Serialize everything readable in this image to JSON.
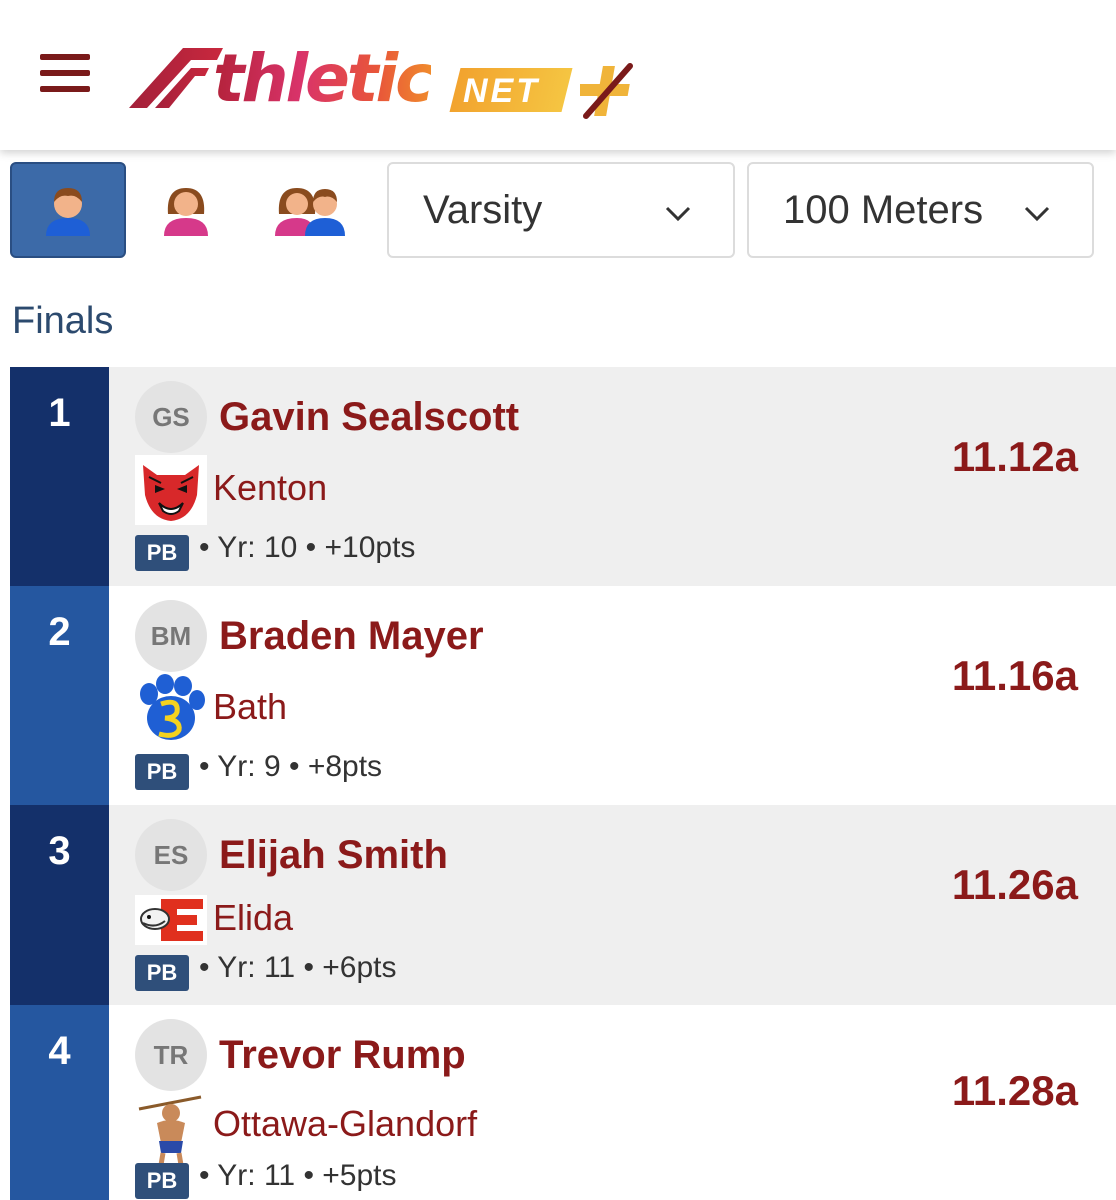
{
  "header": {
    "logo_text": "thletic",
    "logo_net": "NET"
  },
  "filters": {
    "gender_options": [
      {
        "name": "boys",
        "icon": "boy-icon"
      },
      {
        "name": "girls",
        "icon": "girl-icon"
      },
      {
        "name": "both",
        "icon": "both-genders-icon"
      }
    ],
    "division": "Varsity",
    "event": "100 Meters"
  },
  "section_title": "Finals",
  "colors": {
    "brand_maroon": "#8b1a1a",
    "place_dark": "#14306a",
    "place_light": "#2557a0",
    "row_gray": "#efefef",
    "row_white": "#ffffff",
    "pb_badge": "#2f4f7a"
  },
  "results": [
    {
      "place": "1",
      "initials": "GS",
      "name": "Gavin Sealscott",
      "team": "Kenton",
      "badge": "PB",
      "meta": "• Yr: 10 • +10pts",
      "mark": "11.12a"
    },
    {
      "place": "2",
      "initials": "BM",
      "name": "Braden Mayer",
      "team": "Bath",
      "badge": "PB",
      "meta": "• Yr: 9 • +8pts",
      "mark": "11.16a"
    },
    {
      "place": "3",
      "initials": "ES",
      "name": "Elijah Smith",
      "team": "Elida",
      "badge": "PB",
      "meta": "• Yr: 11 • +6pts",
      "mark": "11.26a"
    },
    {
      "place": "4",
      "initials": "TR",
      "name": "Trevor Rump",
      "team": "Ottawa-Glandorf",
      "badge": "PB",
      "meta": "• Yr: 11 • +5pts",
      "mark": "11.28a"
    }
  ]
}
